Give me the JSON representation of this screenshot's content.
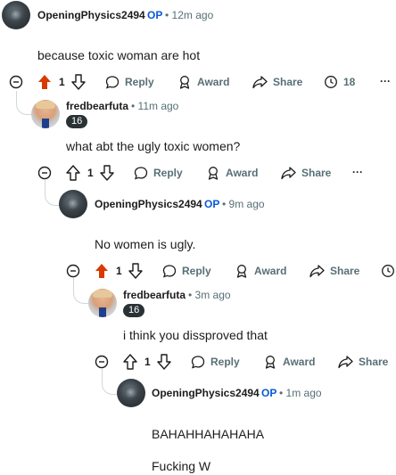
{
  "comments": [
    {
      "author": "OpeningPhysics2494",
      "op_label": "OP",
      "time": "12m ago",
      "body": [
        "because toxic woman are hot"
      ],
      "votes": "1",
      "vote_state": "up",
      "awards_count": "18"
    },
    {
      "author": "fredbearfuta",
      "badge": "16",
      "time": "11m ago",
      "body": [
        "what abt the ugly toxic women?"
      ],
      "votes": "1",
      "vote_state": "none"
    },
    {
      "author": "OpeningPhysics2494",
      "op_label": "OP",
      "time": "9m ago",
      "body": [
        "No women is ugly."
      ],
      "votes": "1",
      "vote_state": "up"
    },
    {
      "author": "fredbearfuta",
      "badge": "16",
      "time": "3m ago",
      "body": [
        "i think you dissproved that"
      ],
      "votes": "1",
      "vote_state": "none"
    },
    {
      "author": "OpeningPhysics2494",
      "op_label": "OP",
      "time": "1m ago",
      "body": [
        "BAHAHHAHAHAHA",
        "Fucking W"
      ]
    }
  ],
  "actions": {
    "reply": "Reply",
    "award": "Award",
    "share": "Share",
    "more": "···"
  },
  "separator": "•",
  "colors": {
    "upvoted": "#d93a00",
    "op_label": "#0a59d8",
    "meta": "#576f76",
    "thread_line": "#d0d7da"
  },
  "icons": [
    "upvote-icon",
    "downvote-icon",
    "reply-icon",
    "award-icon",
    "share-icon",
    "awards-timer-icon",
    "more-icon",
    "collapse-icon"
  ]
}
